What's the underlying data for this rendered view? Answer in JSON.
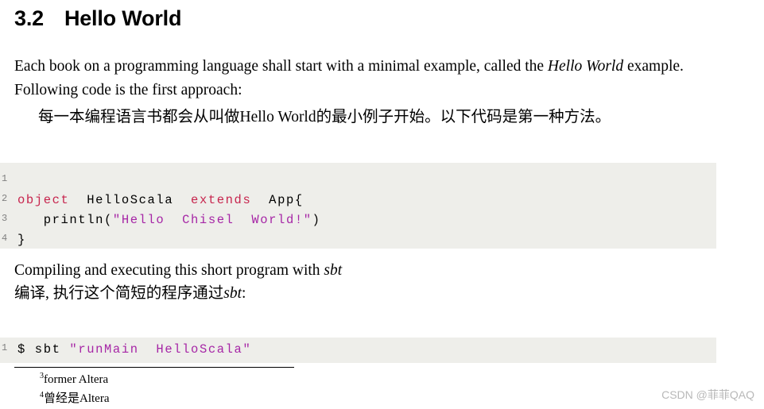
{
  "heading": {
    "number": "3.2",
    "title": "Hello World"
  },
  "paragraphs": {
    "p1_a": "Each book on a programming language shall start with a minimal example, called the ",
    "p1_italic": "Hello World",
    "p1_b": " example.",
    "p2": "Following code is the first approach:",
    "zh1": "每一本编程语言书都会从叫做Hello World的最小例子开始。以下代码是第一种方法。",
    "p3_a": "Compiling and executing this short program with ",
    "p3_italic": "sbt",
    "p4_a": "编译, 执行这个简短的程序通过",
    "p4_italic": "sbt",
    "p4_b": ":"
  },
  "code_block_1": {
    "line_numbers": [
      "1",
      "2",
      "3",
      "4"
    ],
    "lines": [
      {
        "segments": []
      },
      {
        "segments": [
          {
            "text": "object",
            "style": "kw"
          },
          {
            "text": "  HelloScala  ",
            "style": "plain"
          },
          {
            "text": "extends",
            "style": "kw"
          },
          {
            "text": "  App{",
            "style": "plain"
          }
        ]
      },
      {
        "segments": [
          {
            "text": "   println(",
            "style": "plain"
          },
          {
            "text": "\"Hello  Chisel  World!\"",
            "style": "str"
          },
          {
            "text": ")",
            "style": "plain"
          }
        ]
      },
      {
        "segments": [
          {
            "text": "}",
            "style": "plain"
          }
        ]
      }
    ]
  },
  "code_block_2": {
    "line_numbers": [
      "1"
    ],
    "lines": [
      {
        "segments": [
          {
            "text": "$ sbt ",
            "style": "plain"
          },
          {
            "text": "\"runMain  HelloScala\"",
            "style": "str"
          }
        ]
      }
    ]
  },
  "footnotes": [
    {
      "marker": "3",
      "text": "former Altera"
    },
    {
      "marker": "4",
      "text": "曾经是Altera"
    }
  ],
  "watermark": "CSDN @菲菲QAQ"
}
